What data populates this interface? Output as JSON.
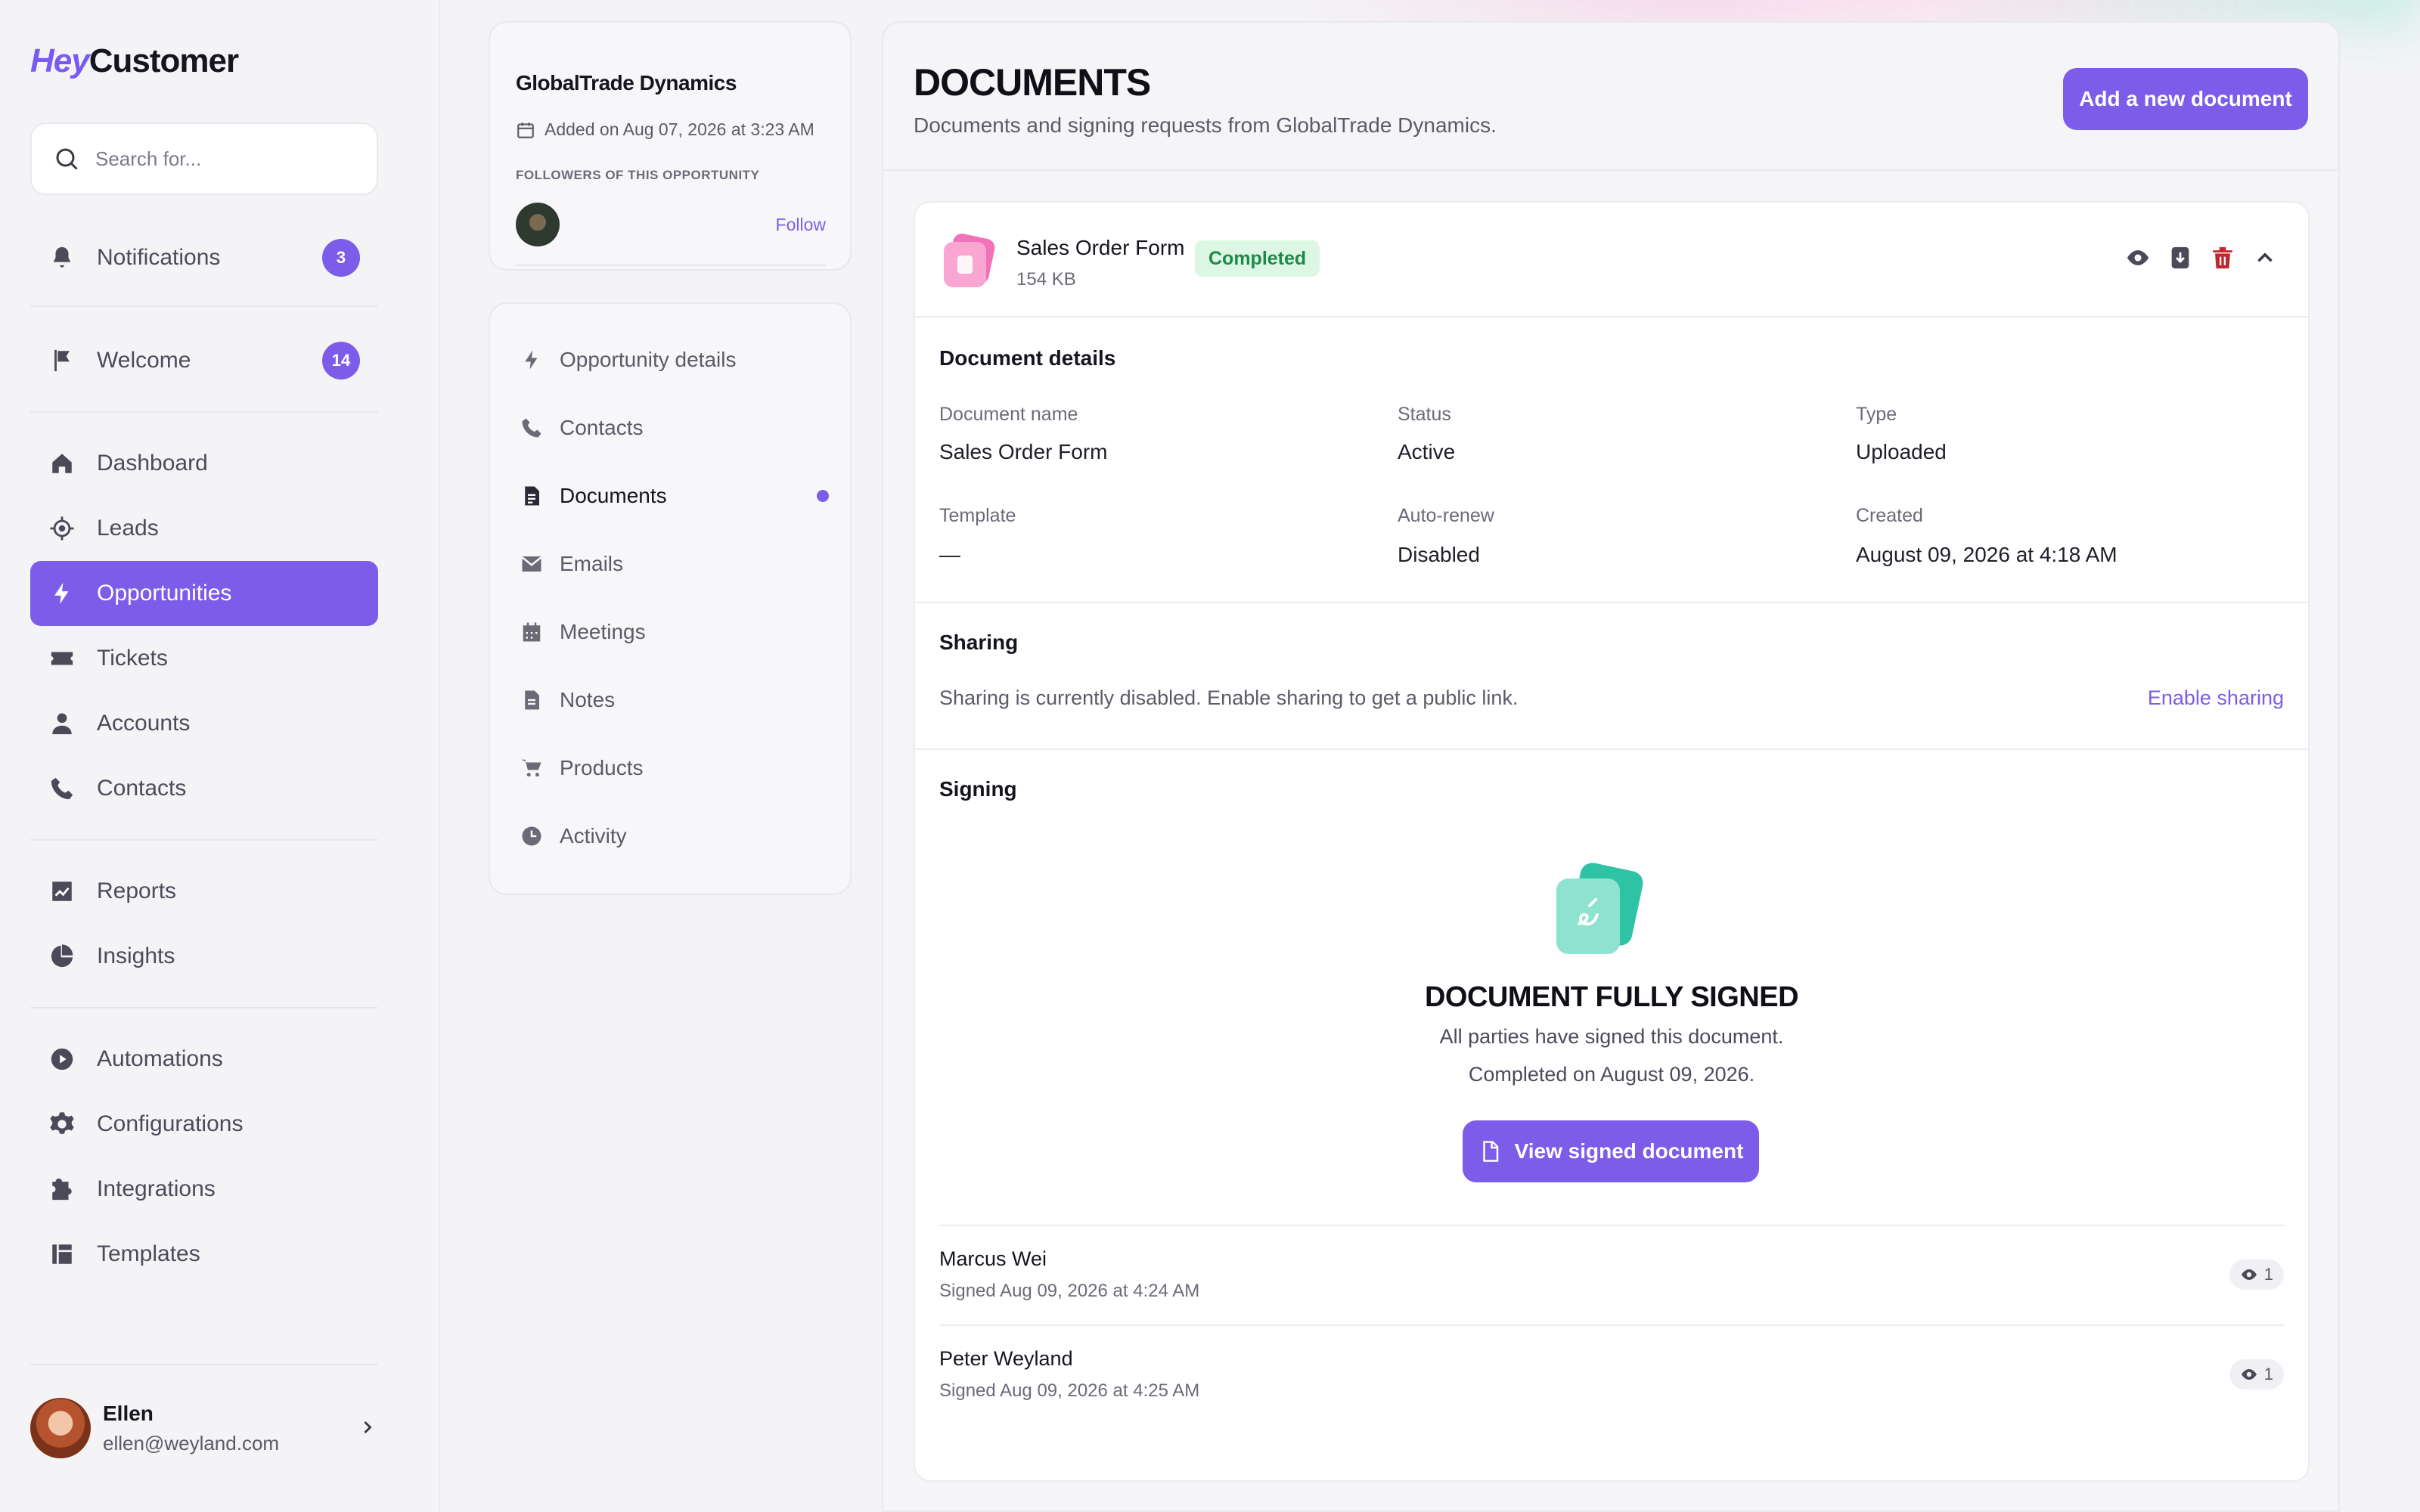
{
  "brand": {
    "hey": "Hey",
    "customer": "Customer"
  },
  "search": {
    "placeholder": "Search for..."
  },
  "sidebar": {
    "top_items": [
      {
        "label": "Notifications",
        "icon": "bell-icon",
        "badge": "3"
      },
      {
        "label": "Welcome",
        "icon": "flag-icon",
        "badge": "14"
      }
    ],
    "main_items": [
      {
        "label": "Dashboard",
        "icon": "home-icon"
      },
      {
        "label": "Leads",
        "icon": "target-icon"
      },
      {
        "label": "Opportunities",
        "icon": "bolt-icon",
        "active": true
      },
      {
        "label": "Tickets",
        "icon": "ticket-icon"
      },
      {
        "label": "Accounts",
        "icon": "user-icon"
      },
      {
        "label": "Contacts",
        "icon": "phone-icon"
      }
    ],
    "report_items": [
      {
        "label": "Reports",
        "icon": "chart-icon"
      },
      {
        "label": "Insights",
        "icon": "pie-icon"
      }
    ],
    "system_items": [
      {
        "label": "Automations",
        "icon": "play-icon"
      },
      {
        "label": "Configurations",
        "icon": "gear-icon"
      },
      {
        "label": "Integrations",
        "icon": "puzzle-icon"
      },
      {
        "label": "Templates",
        "icon": "template-icon"
      }
    ],
    "user": {
      "name": "Ellen",
      "email": "ellen@weyland.com"
    }
  },
  "opportunity": {
    "title": "GlobalTrade Dynamics",
    "added": "Added on Aug 07, 2026 at 3:23 AM",
    "followers_label": "FOLLOWERS OF THIS OPPORTUNITY",
    "follow_label": "Follow"
  },
  "subnav": [
    {
      "label": "Opportunity details",
      "icon": "bolt-icon"
    },
    {
      "label": "Contacts",
      "icon": "phone-icon"
    },
    {
      "label": "Documents",
      "icon": "document-icon",
      "active": true
    },
    {
      "label": "Emails",
      "icon": "mail-icon"
    },
    {
      "label": "Meetings",
      "icon": "calendar-icon"
    },
    {
      "label": "Notes",
      "icon": "note-icon"
    },
    {
      "label": "Products",
      "icon": "cart-icon"
    },
    {
      "label": "Activity",
      "icon": "clock-icon"
    }
  ],
  "main": {
    "title": "DOCUMENTS",
    "subtitle": "Documents and signing requests from GlobalTrade Dynamics.",
    "add_button": "Add a new document"
  },
  "document": {
    "name": "Sales Order Form",
    "size": "154 KB",
    "status_chip": "Completed",
    "details_title": "Document details",
    "fields": {
      "doc_name_label": "Document name",
      "doc_name_value": "Sales Order Form",
      "status_label": "Status",
      "status_value": "Active",
      "type_label": "Type",
      "type_value": "Uploaded",
      "template_label": "Template",
      "template_value": "—",
      "autorenew_label": "Auto-renew",
      "autorenew_value": "Disabled",
      "created_label": "Created",
      "created_value": "August 09, 2026 at 4:18 AM"
    },
    "sharing_title": "Sharing",
    "sharing_text": "Sharing is currently disabled. Enable sharing to get a public link.",
    "enable_sharing": "Enable sharing",
    "signing_title": "Signing",
    "signed_title": "DOCUMENT FULLY SIGNED",
    "signed_line1": "All parties have signed this document.",
    "signed_line2": "Completed on August 09, 2026.",
    "view_signed": "View signed document",
    "signers": [
      {
        "name": "Marcus Wei",
        "meta": "Signed Aug 09, 2026 at 4:24 AM",
        "views": "1"
      },
      {
        "name": "Peter Weyland",
        "meta": "Signed Aug 09, 2026 at 4:25 AM",
        "views": "1"
      }
    ]
  },
  "colors": {
    "accent": "#7c5ce9",
    "success_bg": "#dcf7e4",
    "success_text": "#1e8a4a",
    "danger": "#c0262d",
    "signed_teal": "#3ccab0"
  }
}
